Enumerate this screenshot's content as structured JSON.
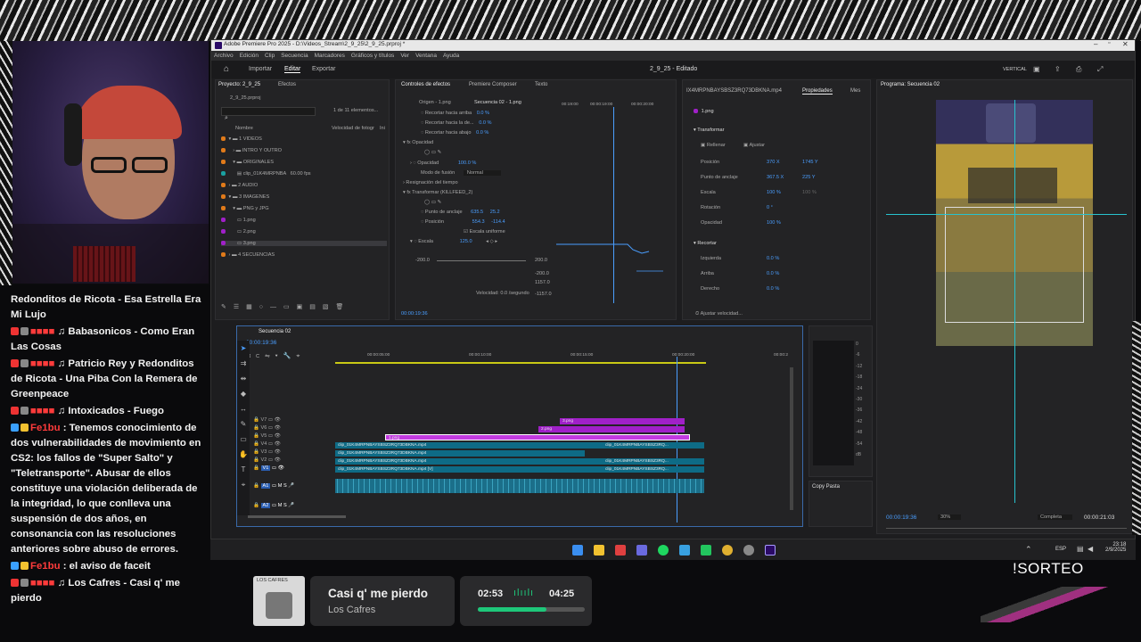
{
  "chat": [
    {
      "user": "",
      "text": "Redonditos de Ricota - Esa Estrella Era Mi Lujo",
      "color": "#ff3b3b"
    },
    {
      "user": "",
      "text": "♫ Babasonicos - Como Eran Las Cosas",
      "color": "#ff3b3b"
    },
    {
      "user": "",
      "text": "♫ Patricio Rey y Redonditos de Ricota - Una Piba Con la Remera de Greenpeace",
      "color": "#ff3b3b"
    },
    {
      "user": "",
      "text": "♫ Intoxicados - Fuego",
      "color": "#ff3b3b"
    },
    {
      "user": "Fe1bu",
      "text": ": Tenemos conocimiento de dos vulnerabilidades de movimiento en CS2: los fallos de \"Super Salto\" y \"Teletransporte\". Abusar de ellos constituye una violación deliberada de la integridad, lo que conlleva una suspensión de dos años, en consonancia con las resoluciones anteriores sobre abuso de errores.",
      "color": "#ff3b3b"
    },
    {
      "user": "Fe1bu",
      "text": ": el aviso de faceit",
      "color": "#ff3b3b"
    },
    {
      "user": "",
      "text": "♫ Los Cafres - Casi q' me pierdo",
      "color": "#ff3b3b"
    }
  ],
  "premiere": {
    "title": "Adobe Premiere Pro 2025 - D:\\Videos_Stream\\2_9_25\\2_9_25.prproj *",
    "menu": [
      "Archivo",
      "Edición",
      "Clip",
      "Secuencia",
      "Marcadores",
      "Gráficos y títulos",
      "Ver",
      "Ventana",
      "Ayuda"
    ],
    "workspaces": [
      "Importar",
      "Editar",
      "Exportar"
    ],
    "center_title": "2_9_25 - Editado",
    "vertical": "VERTICAL",
    "project": {
      "tab": "Proyecto: 2_9_25",
      "tab2": "Efectos",
      "file": "2_9_25.prproj",
      "count": "1 de 11 elementos...",
      "col_name": "Nombre",
      "col_fps": "Velocidad de fotogr",
      "col_fps2": "Ini",
      "items": [
        "1 VIDEOS",
        "INTRO Y OUTRO",
        "ORIGINALES",
        "clip_01K4MRPNBA",
        "2 AUDIO",
        "3 IMAGENES",
        "PNG y JPG",
        "1.png",
        "2.png",
        "3.png",
        "4 SECUENCIAS"
      ],
      "clip_fps": "60.00 fps"
    },
    "effects": {
      "tabs": [
        "Controles de efectos",
        "Premiere Composer",
        "Texto"
      ],
      "origin": "Origen - 1.png",
      "seq": "Secuencia 02 - 1.png",
      "times": [
        "00:19:00",
        "00:00:19:00",
        "00:00:20:00"
      ],
      "rows": [
        "Recortar hacia arriba",
        "Recortar hacia la de...",
        "Recortar hacia abajo",
        "Opacidad",
        "Opacidad",
        "Modo de fusión",
        "Resignación del tiempo",
        "Transformar (KILLFEED_2)",
        "Punto de anclaje",
        "Posición",
        "Escala uniforme",
        "Escala"
      ],
      "vals": [
        "0.0 %",
        "0.0 %",
        "0.0 %",
        "100.0 %",
        "Normal",
        "635.5",
        "25.2",
        "554.3",
        "-114.4",
        "125.0"
      ],
      "graph": [
        "200.0",
        "-200.0",
        "200.0",
        "-200.0",
        "1157.0",
        "-1157.0"
      ],
      "speed": "Velocidad: 0.0 /segundo",
      "tc": "00:00:19:36"
    },
    "props": {
      "clipname": "IX4MRPNBAYSBSZ3RQ73DBKNA.mp4",
      "tab": "Propiedades",
      "tab2": "Mes",
      "layer": "1.png",
      "transform": "Transformar",
      "fill": "Rellenar",
      "fit": "Ajustar",
      "rows": [
        "Posición",
        "Punto de anclaje",
        "Escala",
        "Rotación",
        "Opacidad"
      ],
      "v1": [
        "370 X",
        "367.5 X",
        "100 %",
        "0 °",
        "100 %"
      ],
      "v2": [
        "1745 Y",
        "225 Y",
        "100 %",
        "",
        ""
      ],
      "crop": "Recortar",
      "croprows": [
        "Izquierda",
        "Arriba",
        "Derecho"
      ],
      "cropvals": [
        "0.0 %",
        "0.0 %",
        "0.0 %"
      ],
      "speed": "Ajustar velocidad..."
    },
    "program": {
      "title": "Programa: Secuencia 02",
      "tc": "00:00:19:36",
      "zoom": "30%",
      "quality": "Completa",
      "dur": "00:00:21:03"
    },
    "timeline": {
      "tab": "Secuencia 02",
      "tc": "00:00:19:36",
      "ruler": [
        "00:00:05:00",
        "00:00:10:00",
        "00:00:15:00",
        "00:00:20:00",
        "00:00:2"
      ],
      "tracks": [
        "V7",
        "V6",
        "V5",
        "V4",
        "V3",
        "V2",
        "V1",
        "A1",
        "A2"
      ],
      "clips": [
        "3.png",
        "2.png",
        "1.png",
        "clip_01K4MRPNBAYSBSZ3RQ73DBKNA.mp4",
        "clip_01K4MRPNBAYSBSZ3RQ73DBKNA.mp4",
        "clip_01K4MRPNBAYSBSZ3RQ73DBKNA.mp4",
        "clip_01K4MRPNBAYSBSZ3RQ73DBKNA.mp4 [V]",
        "clip_01K4MRPNBAYSBSZ3RQ...",
        "clip_01K4MRPNBAYSBSZ3RQ...",
        "clip_01K4MRPNBAYSBSZ3RQ..."
      ],
      "fx": "fx"
    },
    "meter": {
      "labels": [
        "0",
        "-6",
        "-12",
        "-18",
        "-24",
        "-30",
        "-36",
        "-42",
        "-48",
        "-54",
        "dB"
      ],
      "s": "S",
      "s2": "S"
    },
    "copy": "Copy Pasta"
  },
  "taskbar": {
    "lang": "ESP",
    "time": "23:18",
    "date": "2/9/2025"
  },
  "music": {
    "title": "Casi q' me pierdo",
    "artist": "Los Cafres",
    "elapsed": "02:53",
    "total": "04:25",
    "progress": 0.64,
    "album": "LOS CAFRES"
  },
  "sorteo": "!SORTEO",
  "colors": {
    "accent": "#4a9eff",
    "purple": "#a020c8",
    "teal": "#0e6b86",
    "chatred": "#ff3b3b",
    "green": "#1ec77a"
  }
}
